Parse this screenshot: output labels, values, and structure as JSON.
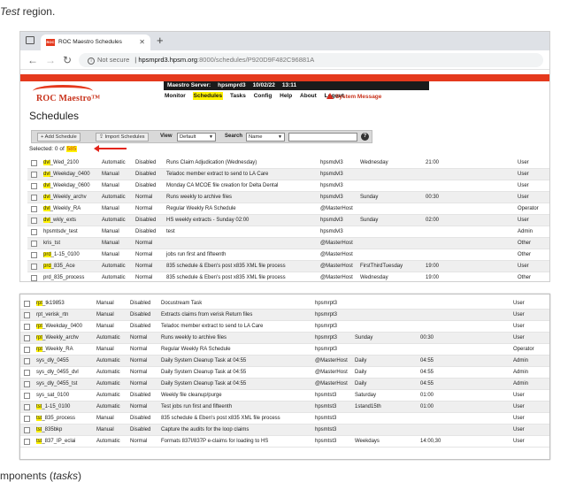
{
  "doc": {
    "top_text": "Test",
    "top_text_rest": " region.",
    "bottom_text_prefix": "mponents (",
    "bottom_text_italic": "tasks",
    "bottom_text_suffix": ")"
  },
  "browser": {
    "tab_title": "ROC Maestro Schedules",
    "tab_favicon_text": "ROC",
    "not_secure": "Not secure",
    "url_domain": "hpsmprd3.hpsm.org",
    "url_path": ":8000/schedules/P920D9F482C96881A"
  },
  "app": {
    "logo": "ROC Maestro™",
    "server_label": "Maestro Server:",
    "server_name": "hpsmprd3",
    "date": "10/02/22",
    "time": "13:11",
    "menu": [
      "Monitor",
      "Schedules",
      "Tasks",
      "Config",
      "Help",
      "About",
      "Logout"
    ],
    "active_menu": "Schedules",
    "system_message": "System Message",
    "page_title": "Schedules",
    "add_button": "+ Add Schedule",
    "import_button": "Import Schedules",
    "view_label": "View",
    "view_value": "Default",
    "search_label": "Search",
    "search_field_value": "Name",
    "help_icon": "?",
    "selected_prefix": "Selected: 0 of",
    "selected_count": "585"
  },
  "table1_rows": [
    {
      "prefix": "dvl",
      "rest": "_Wed_2100",
      "type": "Automatic",
      "status": "Disabled",
      "desc": "Runs Claim Adjudication (Wednesday)",
      "host": "hpsmdvl3",
      "day": "Wednesday",
      "time": "21:00",
      "role": "User"
    },
    {
      "prefix": "dvl",
      "rest": "_Weekday_0400",
      "type": "Manual",
      "status": "Disabled",
      "desc": "Teladoc member extract to send to LA Care",
      "host": "hpsmdvl3",
      "day": "",
      "time": "",
      "role": "User"
    },
    {
      "prefix": "dvl",
      "rest": "_Weekday_0600",
      "type": "Manual",
      "status": "Disabled",
      "desc": "Monday CA MCOE file creation for Delta Dental",
      "host": "hpsmdvl3",
      "day": "",
      "time": "",
      "role": "User"
    },
    {
      "prefix": "dvl",
      "rest": "_Weekly_archv",
      "type": "Automatic",
      "status": "Normal",
      "desc": "Runs weekly to archive files",
      "host": "hpsmdvl3",
      "day": "Sunday",
      "time": "00:30",
      "role": "User"
    },
    {
      "prefix": "dvl",
      "rest": "_Weekly_RA",
      "type": "Manual",
      "status": "Normal",
      "desc": "Regular Weekly RA Schedule",
      "host": "@MasterHost",
      "day": "",
      "time": "",
      "role": "Operator"
    },
    {
      "prefix": "dvl",
      "rest": "_wkly_exts",
      "type": "Automatic",
      "status": "Disabled",
      "desc": "HS weekly extracts - Sunday 02:00",
      "host": "hpsmdvl3",
      "day": "Sunday",
      "time": "02:00",
      "role": "User"
    },
    {
      "prefix": "",
      "rest": "hpsmtsdv_test",
      "type": "Manual",
      "status": "Disabled",
      "desc": "test",
      "host": "hpsmdvl3",
      "day": "",
      "time": "",
      "role": "Admin"
    },
    {
      "prefix": "",
      "rest": "kris_tst",
      "type": "Manual",
      "status": "Normal",
      "desc": "",
      "host": "@MasterHost",
      "day": "",
      "time": "",
      "role": "Other"
    },
    {
      "prefix": "prd",
      "rest": "_1-15_0100",
      "type": "Manual",
      "status": "Normal",
      "desc": "jobs run first and fifteenth",
      "host": "@MasterHost",
      "day": "",
      "time": "",
      "role": "Other"
    },
    {
      "prefix": "prd",
      "rest": "_835_Ace",
      "type": "Automatic",
      "status": "Normal",
      "desc": "835 schedule & Eben's post x835 XML file process",
      "host": "@MasterHost",
      "day": "FirstThirdTuesday",
      "time": "19:00",
      "role": "User"
    },
    {
      "prefix": "",
      "rest": "prd_835_process",
      "type": "Automatic",
      "status": "Normal",
      "desc": "835 schedule & Eben's post x835 XML file process",
      "host": "@MasterHost",
      "day": "Wednesday",
      "time": "19:00",
      "role": "Other"
    }
  ],
  "table2_rows": [
    {
      "prefix": "rpt",
      "rest": "_tk19853",
      "type": "Manual",
      "status": "Disabled",
      "desc": "Docustream Task",
      "host": "hpsmrpt3",
      "day": "",
      "time": "",
      "role": "User"
    },
    {
      "prefix": "",
      "rest": "rpt_verisk_rtn",
      "type": "Manual",
      "status": "Disabled",
      "desc": "Extracts claims from verisk Return files",
      "host": "hpsmrpt3",
      "day": "",
      "time": "",
      "role": "User"
    },
    {
      "prefix": "rpt",
      "rest": "_Weekday_0400",
      "type": "Manual",
      "status": "Disabled",
      "desc": "Teladoc member extract to send to LA Care",
      "host": "hpsmrpt3",
      "day": "",
      "time": "",
      "role": "User"
    },
    {
      "prefix": "rpt",
      "rest": "_Weekly_archv",
      "type": "Automatic",
      "status": "Normal",
      "desc": "Runs weekly to archive files",
      "host": "hpsmrpt3",
      "day": "Sunday",
      "time": "00:30",
      "role": "User"
    },
    {
      "prefix": "rpt",
      "rest": "_Weekly_RA",
      "type": "Manual",
      "status": "Normal",
      "desc": "Regular Weekly RA Schedule",
      "host": "hpsmrpt3",
      "day": "",
      "time": "",
      "role": "Operator"
    },
    {
      "prefix": "",
      "rest": "sys_dly_0455",
      "type": "Automatic",
      "status": "Normal",
      "desc": "Daily System Cleanup Task at 04:55",
      "host": "@MasterHost",
      "day": "Daily",
      "time": "04:55",
      "role": "Admin"
    },
    {
      "prefix": "",
      "rest": "sys_dly_0455_dvl",
      "type": "Automatic",
      "status": "Normal",
      "desc": "Daily System Cleanup Task at 04:55",
      "host": "@MasterHost",
      "day": "Daily",
      "time": "04:55",
      "role": "Admin"
    },
    {
      "prefix": "",
      "rest": "sys_dly_0455_tst",
      "type": "Automatic",
      "status": "Normal",
      "desc": "Daily System Cleanup Task at 04:55",
      "host": "@MasterHost",
      "day": "Daily",
      "time": "04:55",
      "role": "Admin"
    },
    {
      "prefix": "",
      "rest": "sys_sat_0100",
      "type": "Automatic",
      "status": "Disabled",
      "desc": "Weekly file cleanup/purge",
      "host": "hpsmtst3",
      "day": "Saturday",
      "time": "01:00",
      "role": "User"
    },
    {
      "prefix": "tst",
      "rest": "_1-15_0100",
      "type": "Automatic",
      "status": "Normal",
      "desc": "Test jobs run first and fifteenth",
      "host": "hpsmtst3",
      "day": "1stand15th",
      "time": "01:00",
      "role": "User"
    },
    {
      "prefix": "tst",
      "rest": "_835_process",
      "type": "Manual",
      "status": "Disabled",
      "desc": "835 schedule & Eben's post x835 XML file process",
      "host": "hpsmtst3",
      "day": "",
      "time": "",
      "role": "User"
    },
    {
      "prefix": "tst",
      "rest": "_835bkp",
      "type": "Manual",
      "status": "Disabled",
      "desc": "Capture the audits for the loop claims",
      "host": "hpsmtst3",
      "day": "",
      "time": "",
      "role": "User"
    },
    {
      "prefix": "tst",
      "rest": "_837_IP_eclai",
      "type": "Automatic",
      "status": "Normal",
      "desc": "Formats 837I/837P e-claims for loading to HS",
      "host": "hpsmtst3",
      "day": "Weekdays",
      "time": "14:00,30",
      "role": "User"
    }
  ]
}
